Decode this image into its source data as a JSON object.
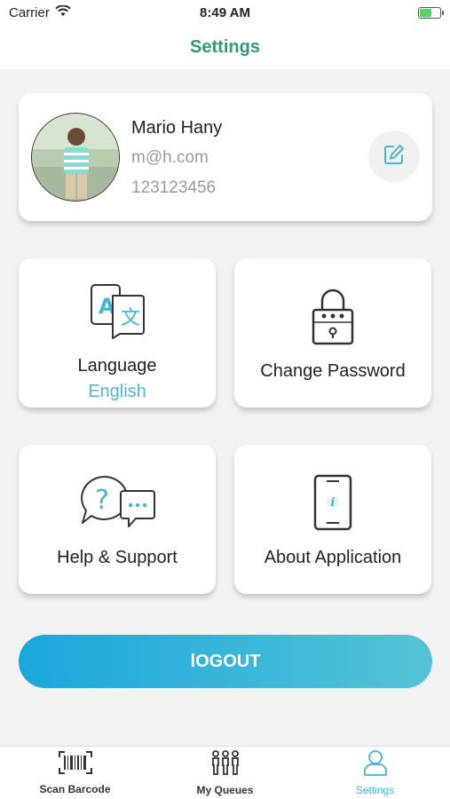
{
  "status_bar": {
    "carrier": "Carrier",
    "time": "8:49 AM"
  },
  "header": {
    "title": "Settings"
  },
  "profile": {
    "name": "Mario Hany",
    "email": "m@h.com",
    "phone": "123123456"
  },
  "tiles": {
    "language_label": "Language",
    "language_value": "English",
    "change_password_label": "Change Password",
    "help_label": "Help & Support",
    "about_label": "About Application"
  },
  "logout": {
    "label": "lOGOUT"
  },
  "tab_bar": {
    "items": [
      {
        "label": "Scan Barcode",
        "icon": "barcode-icon"
      },
      {
        "label": "My Queues",
        "icon": "queue-icon"
      },
      {
        "label": "Settings",
        "icon": "user-icon",
        "active": true
      }
    ]
  },
  "colors": {
    "accent_green": "#2e9a78",
    "accent_blue": "#4ab8d6",
    "logout_gradient_start": "#1aa7dc",
    "logout_gradient_end": "#55c3d6"
  }
}
